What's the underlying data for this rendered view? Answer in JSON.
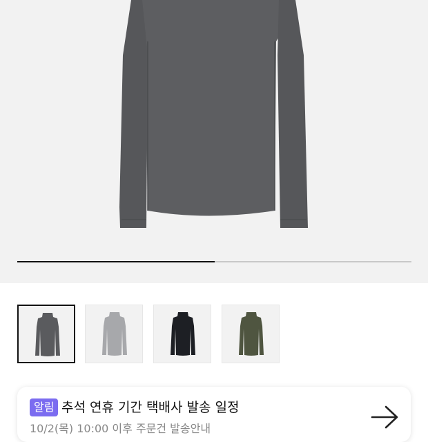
{
  "product": {
    "image": "charcoal-turtleneck-long-sleeve",
    "slider_progress": 0.5
  },
  "thumbnails": [
    {
      "name": "charcoal",
      "color": "#5a5b5e",
      "selected": true
    },
    {
      "name": "light-gray",
      "color": "#a7a8ab",
      "selected": false
    },
    {
      "name": "black",
      "color": "#1d1f24",
      "selected": false
    },
    {
      "name": "olive",
      "color": "#4f5540",
      "selected": false
    }
  ],
  "notice": {
    "badge": "알림",
    "title": "추석 연휴 기간 택배사 발송 일정",
    "subtitle": "10/2(목) 10:00 이후 주문건 발송안내",
    "arrow_icon": "arrow-right-icon"
  },
  "colors": {
    "accent": "#7b6cf0",
    "hero_bg": "#f2f2f2"
  }
}
